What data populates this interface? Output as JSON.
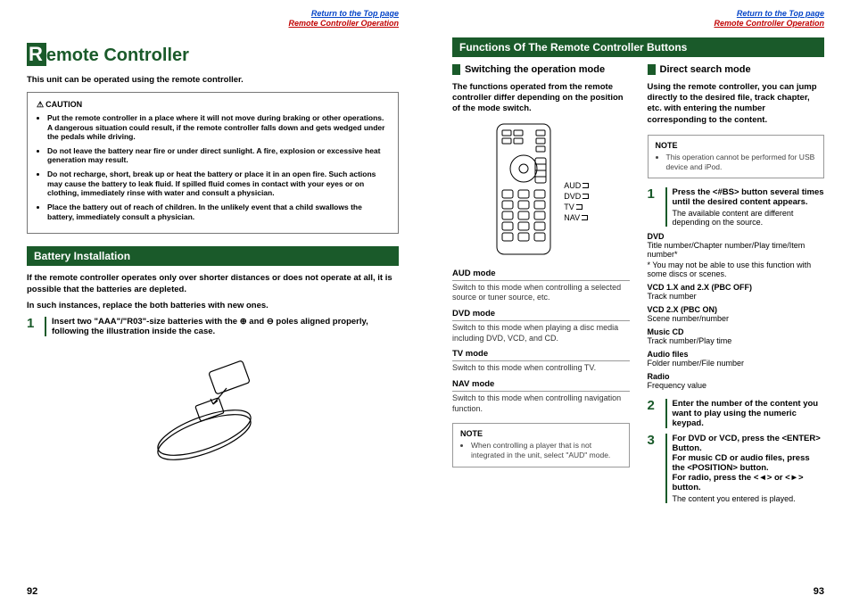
{
  "links": {
    "top": "Return to the Top page",
    "section": "Remote Controller Operation"
  },
  "left": {
    "title_big": "R",
    "title_rest": "emote Controller",
    "intro": "This unit can be operated using the remote controller.",
    "caution_title": "CAUTION",
    "cautions": [
      "Put the remote controller in a place where it will not move during braking or other operations. A dangerous situation could result, if the remote controller falls down and gets wedged under the pedals while driving.",
      "Do not leave the battery near fire or under direct sunlight. A fire, explosion or excessive heat generation may result.",
      "Do not recharge, short, break up or heat the battery or place it in an open fire. Such actions may cause the battery to leak fluid. If spilled fluid comes in contact with your eyes or on clothing, immediately rinse with water and consult a physician.",
      "Place the battery out of reach of children. In the unlikely event that a child swallows the battery, immediately consult a physician."
    ],
    "battery_heading": "Battery Installation",
    "battery_p1": "If the remote controller operates only over shorter distances or does not operate at all, it is possible that the batteries are depleted.",
    "battery_p2": "In such instances, replace the both batteries with new ones.",
    "battery_step_num": "1",
    "battery_step": "Insert two \"AAA\"/\"R03\"-size batteries with the ⊕ and ⊖ poles aligned properly, following the illustration inside the case.",
    "page_num": "92"
  },
  "right": {
    "func_heading": "Functions Of The Remote Controller Buttons",
    "switch_heading": "Switching the operation mode",
    "switch_desc": "The functions operated from the remote controller differ depending on the position of the mode switch.",
    "mode_labels": [
      "AUD",
      "DVD",
      "TV",
      "NAV"
    ],
    "modes": [
      {
        "t": "AUD mode",
        "d": "Switch to this mode when controlling a selected source or tuner source, etc."
      },
      {
        "t": "DVD mode",
        "d": "Switch to this mode when playing a disc media including DVD, VCD, and CD."
      },
      {
        "t": "TV mode",
        "d": "Switch to this mode when controlling TV."
      },
      {
        "t": "NAV mode",
        "d": "Switch to this mode when controlling navigation function."
      }
    ],
    "note_left_title": "NOTE",
    "note_left": "When controlling a player that is not integrated in the unit, select \"AUD\" mode.",
    "direct_heading": "Direct search mode",
    "direct_desc": "Using the remote controller, you can jump directly to the desired file, track chapter, etc. with entering the number corresponding to the content.",
    "note_right_title": "NOTE",
    "note_right": "This operation cannot be performed for USB device and iPod.",
    "steps": [
      {
        "n": "1",
        "lead": "Press the <#BS> button several times until the desired content appears.",
        "sub": "The available content are different depending on the source."
      },
      {
        "n": "2",
        "lead": "Enter the number of the content you want to play using the numeric keypad."
      },
      {
        "n": "3",
        "lead": "For DVD or VCD, press the <ENTER> Button.\nFor music CD or audio files, press the <POSITION> button.\nFor radio, press the <◄> or <►> button.",
        "sub": "The content you entered is played."
      }
    ],
    "defs": [
      {
        "t": "DVD",
        "d": "Title number/Chapter number/Play time/Item number*",
        "extra": "* You may not be able to use this function with some discs or scenes."
      },
      {
        "t": "VCD 1.X and 2.X (PBC OFF)",
        "d": "Track number"
      },
      {
        "t": "VCD 2.X (PBC ON)",
        "d": "Scene number/number"
      },
      {
        "t": "Music CD",
        "d": "Track number/Play time"
      },
      {
        "t": "Audio files",
        "d": "Folder number/File number"
      },
      {
        "t": "Radio",
        "d": "Frequency value"
      }
    ],
    "page_num": "93"
  }
}
